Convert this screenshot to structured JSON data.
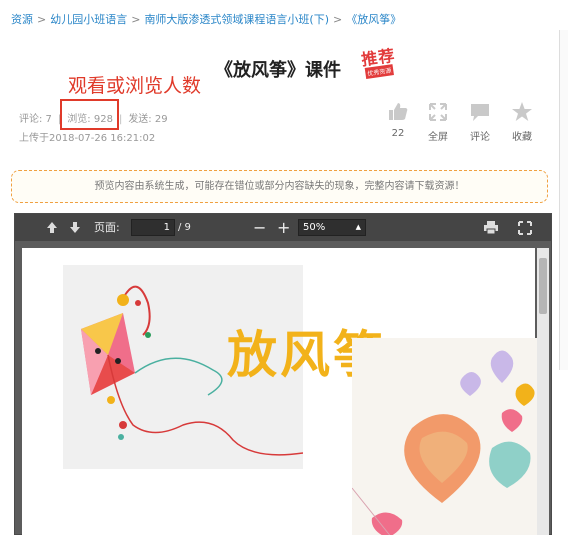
{
  "breadcrumb": {
    "items": [
      "资源",
      "幼儿园小班语言",
      "南师大版渗透式领域课程语言小班(下)",
      "《放风筝》"
    ],
    "separator": ">"
  },
  "title": "《放风筝》课件",
  "stamp": {
    "main": "推荐",
    "sub": "优秀资源"
  },
  "annotation": "观看或浏览人数",
  "stats": {
    "comments_label": "评论: 7",
    "views_label": "浏览: 928",
    "downloads_label": "发送: 29",
    "upload_time": "上传于2018-07-26 16:21:02"
  },
  "actions": [
    {
      "icon": "thumbs-up-icon",
      "label": "22"
    },
    {
      "icon": "fullscreen-icon",
      "label": "全屏"
    },
    {
      "icon": "comment-icon",
      "label": "评论"
    },
    {
      "icon": "star-icon",
      "label": "收藏"
    }
  ],
  "notice": "预览内容由系统生成，可能存在错位或部分内容缺失的现象，完整内容请下载资源！",
  "viewer": {
    "page_label": "页面:",
    "current_page": "1",
    "total_pages": "/ 9",
    "zoom": "50%"
  },
  "document": {
    "heading": "放风筝"
  },
  "colors": {
    "link": "#2a86c8",
    "annotation": "#e03a2a",
    "heading": "#f2b21a",
    "toolbar": "#454545"
  }
}
